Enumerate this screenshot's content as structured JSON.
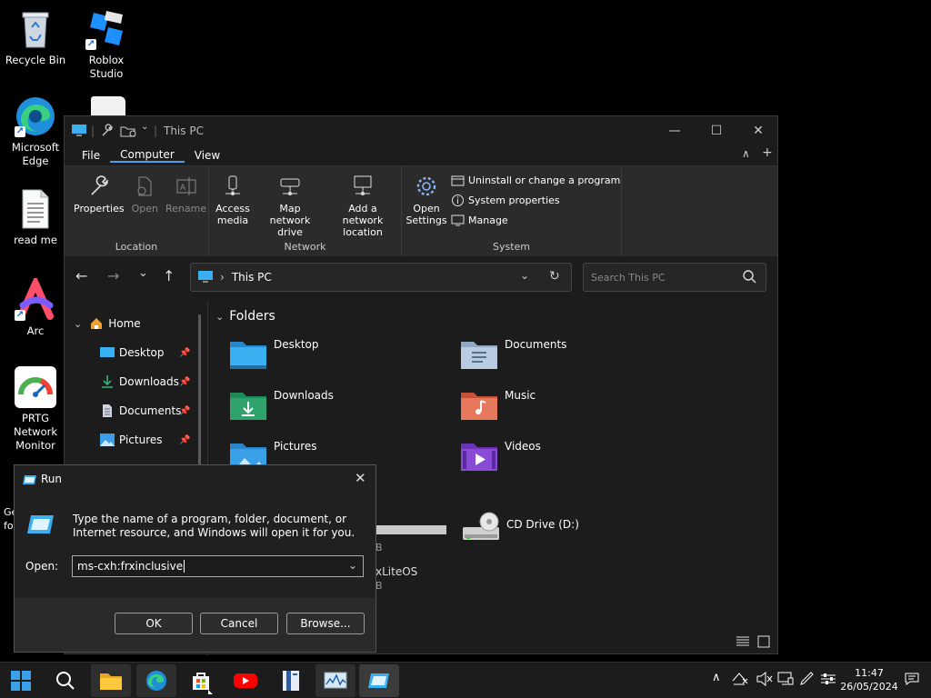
{
  "desktop": {
    "icons": [
      {
        "label": "Recycle Bin"
      },
      {
        "label": "Roblox Studio"
      },
      {
        "label": "Microsoft Edge"
      },
      {
        "label": "read me"
      },
      {
        "label": "Arc"
      },
      {
        "label": "PRTG Network Monitor"
      },
      {
        "label": "Ge fo"
      }
    ]
  },
  "explorer": {
    "title": "This PC",
    "menu_tabs": [
      "File",
      "Computer",
      "View"
    ],
    "active_tab": "Computer",
    "ribbon": {
      "location": {
        "label": "Location",
        "buttons": [
          "Properties",
          "Open",
          "Rename"
        ]
      },
      "network": {
        "label": "Network",
        "buttons": [
          "Access media",
          "Map network drive",
          "Add a network location"
        ]
      },
      "system": {
        "label": "System",
        "open_settings": "Open Settings",
        "links": [
          "Uninstall or change a program",
          "System properties",
          "Manage"
        ]
      }
    },
    "address": "This PC",
    "search_placeholder": "Search This PC",
    "nav": [
      {
        "label": "Home"
      },
      {
        "label": "Desktop"
      },
      {
        "label": "Downloads"
      },
      {
        "label": "Documents"
      },
      {
        "label": "Pictures"
      }
    ],
    "section_title": "Folders",
    "folders": [
      "Desktop",
      "Documents",
      "Downloads",
      "Music",
      "Pictures",
      "Videos"
    ],
    "drives": [
      {
        "label": "CD Drive (D:)"
      },
      {
        "label_fragment": "xLiteOS"
      },
      {
        "size_fragment": "B"
      }
    ]
  },
  "run_dialog": {
    "title": "Run",
    "description": "Type the name of a program, folder, document, or Internet resource, and Windows will open it for you.",
    "open_label": "Open:",
    "input_value": "ms-cxh:frxinclusive",
    "ok": "OK",
    "cancel": "Cancel",
    "browse": "Browse..."
  },
  "taskbar": {
    "time": "11:47",
    "date": "26/05/2024"
  },
  "colors": {
    "accent": "#4ca0e0",
    "folder_blue": "#3aa0e8",
    "folder_green": "#2fa36b",
    "videos": "#8a4bd6",
    "music": "#e06a50"
  }
}
